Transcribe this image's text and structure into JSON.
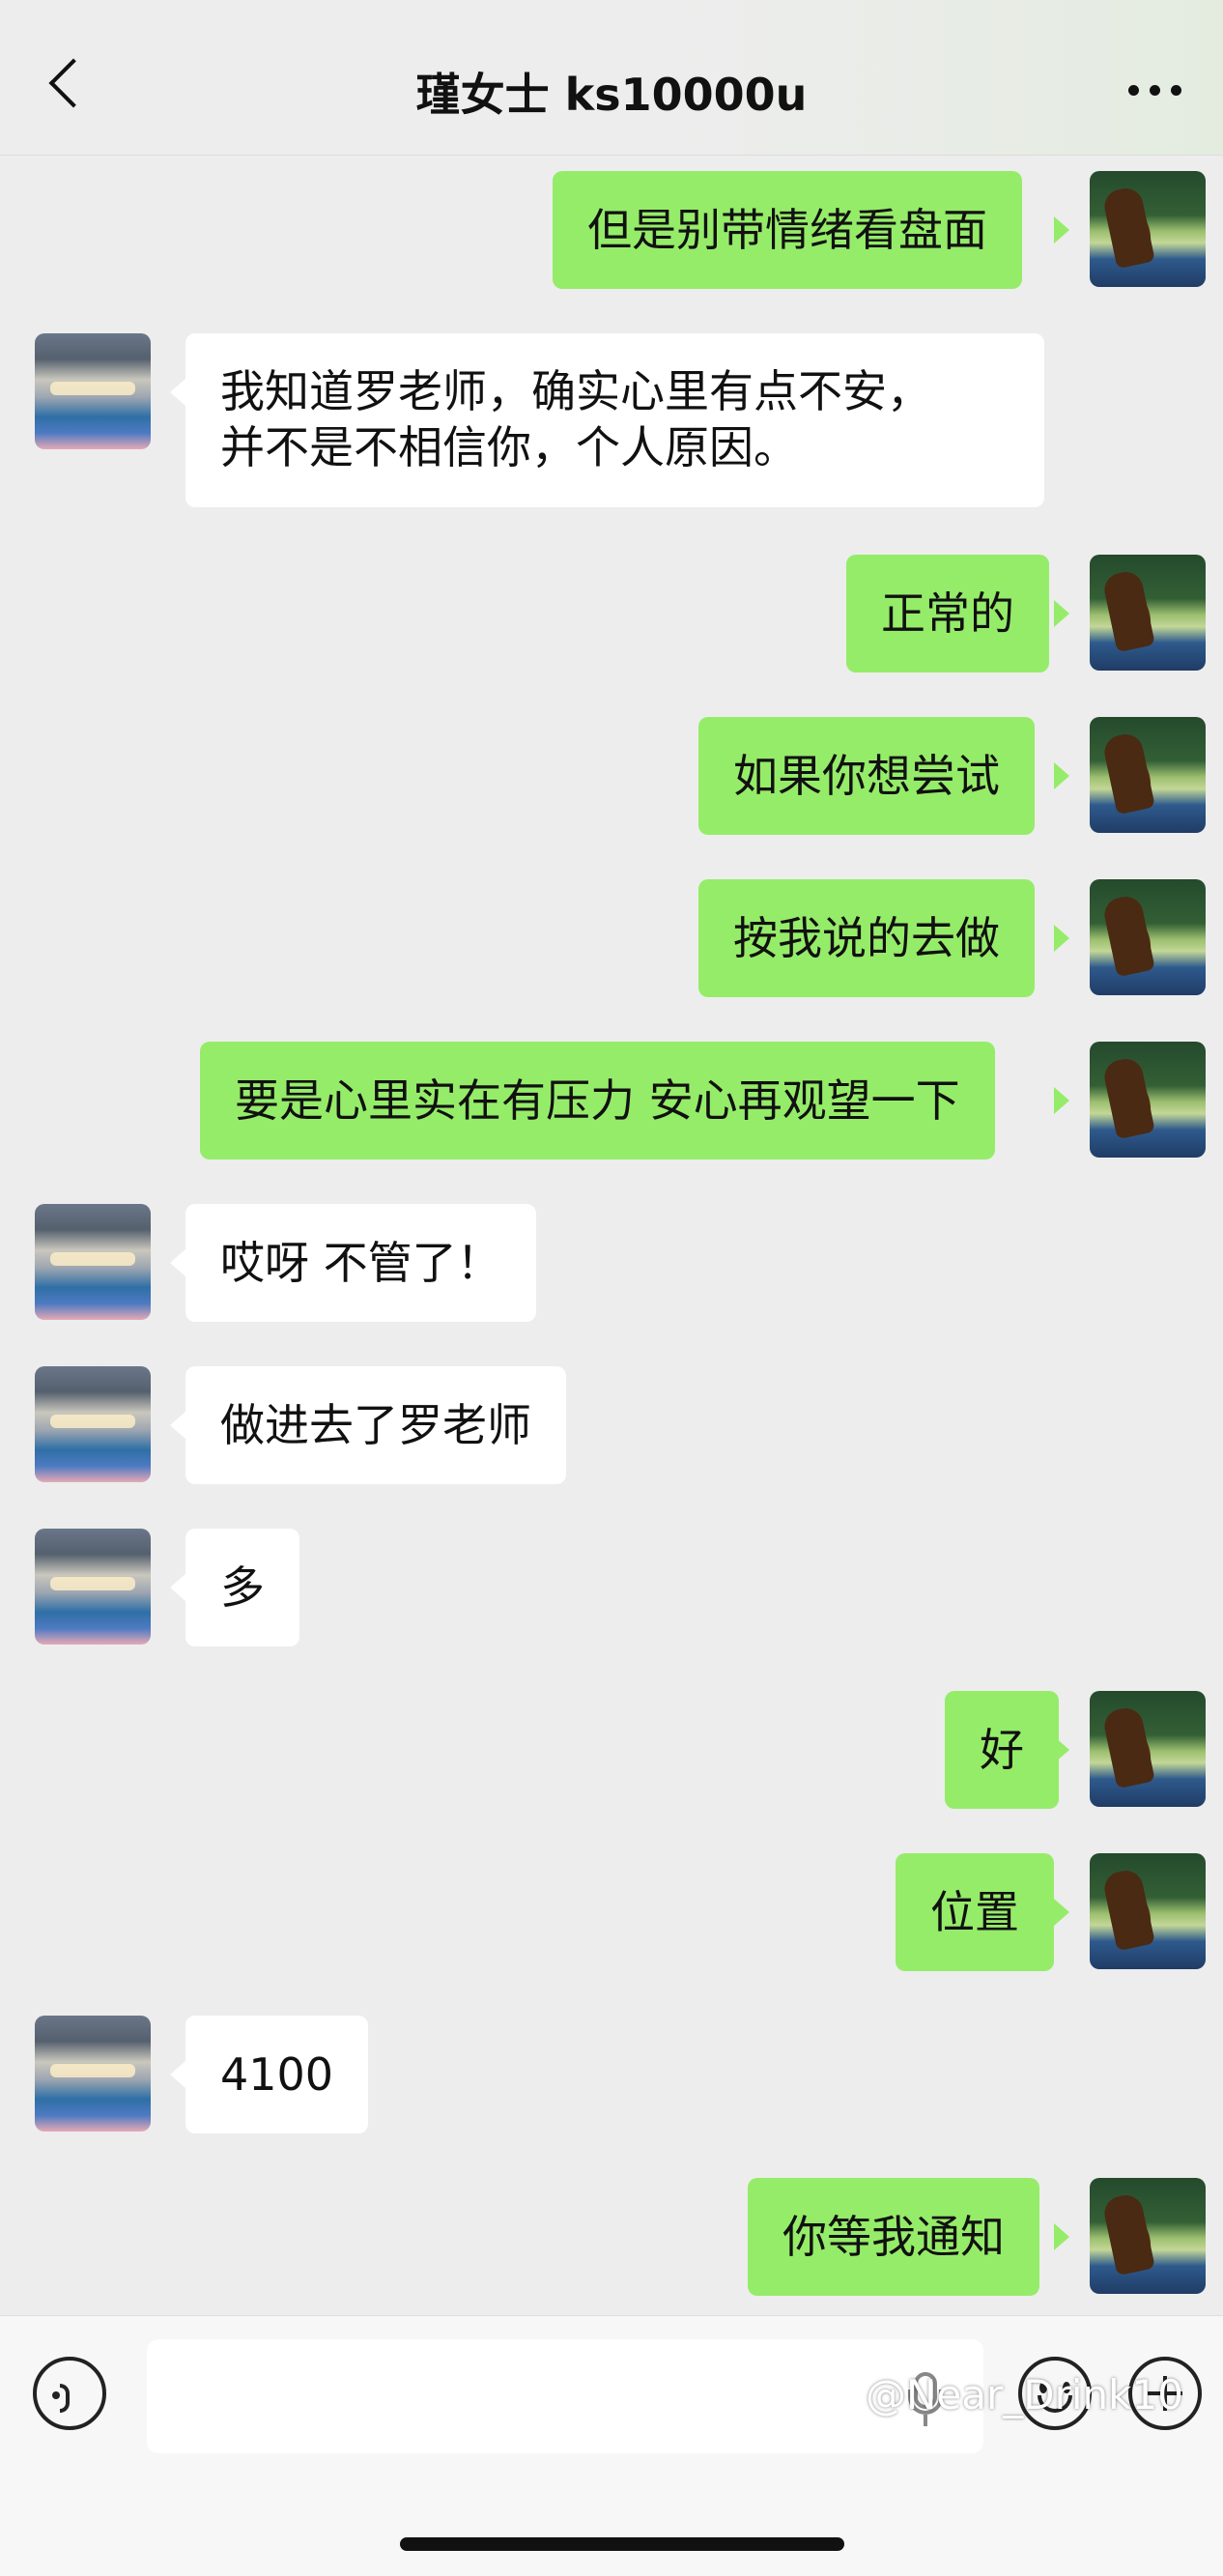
{
  "header": {
    "title": "瑾女士 ks10000u",
    "back_icon": "chevron-left-icon",
    "more_icon": "more-dots-icon"
  },
  "messages": [
    {
      "from": "me",
      "text": "但是别带情绪看盘面"
    },
    {
      "from": "other",
      "lines": [
        "我知道罗老师，确实心里有点不安，",
        "并不是不相信你，个人原因。"
      ]
    },
    {
      "from": "me",
      "text": "正常的"
    },
    {
      "from": "me",
      "text": "如果你想尝试"
    },
    {
      "from": "me",
      "text": "按我说的去做"
    },
    {
      "from": "me",
      "text": "要是心里实在有压力 安心再观望一下"
    },
    {
      "from": "other",
      "text": "哎呀 不管了！"
    },
    {
      "from": "other",
      "text": "做进去了罗老师"
    },
    {
      "from": "other",
      "text": "多"
    },
    {
      "from": "me",
      "text": "好"
    },
    {
      "from": "me",
      "text": "位置"
    },
    {
      "from": "other",
      "text": "4100"
    },
    {
      "from": "me",
      "text": "你等我通知"
    }
  ],
  "input_bar": {
    "voice_icon": "voice-input-icon",
    "mic_icon": "microphone-icon",
    "emoji_icon": "emoji-icon",
    "plus_icon": "plus-icon",
    "text_value": ""
  },
  "watermark": "@Near_Drink10",
  "colors": {
    "background": "#ededed",
    "outgoing_bubble": "#95ec69",
    "incoming_bubble": "#ffffff"
  }
}
